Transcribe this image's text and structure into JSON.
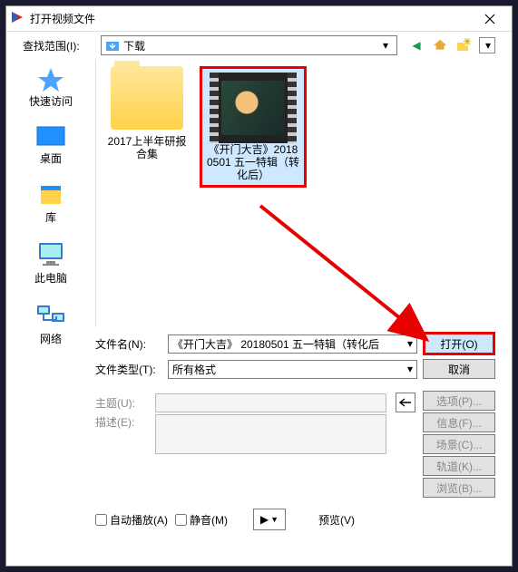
{
  "title": "打开视频文件",
  "lookin_label": "查找范围(I):",
  "lookin_value": "下载",
  "places": [
    {
      "label": "快速访问"
    },
    {
      "label": "桌面"
    },
    {
      "label": "库"
    },
    {
      "label": "此电脑"
    },
    {
      "label": "网络"
    }
  ],
  "files": [
    {
      "name": "2017上半年研报合集",
      "type": "folder"
    },
    {
      "name": "《开门大吉》20180501 五一特辑（转化后）",
      "type": "video",
      "selected": true
    }
  ],
  "filename_label": "文件名(N):",
  "filename_value": "《开门大吉》 20180501 五一特辑（转化后",
  "filetype_label": "文件类型(T):",
  "filetype_value": "所有格式",
  "open_btn": "打开(O)",
  "cancel_btn": "取消",
  "subject_label": "主题(U):",
  "desc_label": "描述(E):",
  "side_buttons": [
    "选项(P)...",
    "信息(F)...",
    "场景(C)...",
    "轨道(K)...",
    "浏览(B)..."
  ],
  "autoplay_label": "自动播放(A)",
  "mute_label": "静音(M)",
  "preview_label": "预览(V)"
}
